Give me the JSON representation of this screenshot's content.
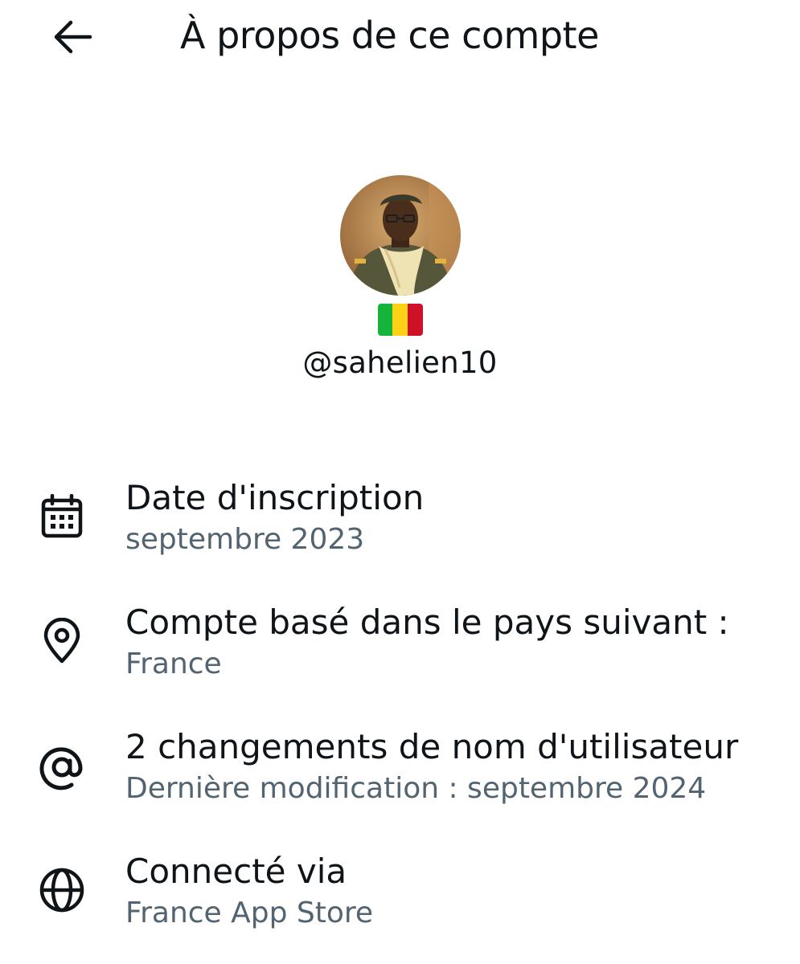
{
  "header": {
    "back_icon": "arrow-left-icon",
    "title": "À propos de ce compte"
  },
  "profile": {
    "avatar_icon": "profile-photo",
    "flag_icon": "mali-flag",
    "flag_colors": [
      "#14b53a",
      "#fcd116",
      "#ce1126"
    ],
    "handle": "@sahelien10"
  },
  "info": [
    {
      "icon": "calendar-icon",
      "title": "Date d'inscription",
      "value": "septembre 2023"
    },
    {
      "icon": "location-pin-icon",
      "title": "Compte basé dans le pays suivant :",
      "value": "France"
    },
    {
      "icon": "at-sign-icon",
      "title": "2 changements de nom d'utilisateur",
      "value": "Dernière modification : septembre 2024"
    },
    {
      "icon": "globe-icon",
      "title": "Connecté via",
      "value": "France App Store"
    }
  ],
  "colors": {
    "primary_text": "#0f1419",
    "secondary_text": "#536471",
    "background": "#ffffff"
  }
}
